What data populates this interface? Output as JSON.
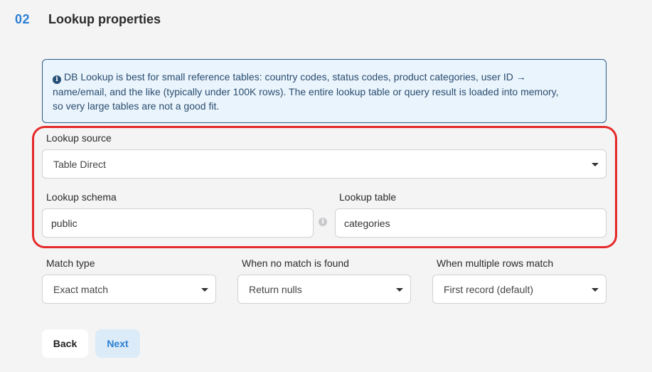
{
  "header": {
    "step_number": "02",
    "title": "Lookup properties"
  },
  "info": {
    "line1": "DB Lookup is best for small reference tables: country codes, status codes, product categories, user ID →",
    "line2": "name/email, and the like (typically under 100K rows). The entire lookup table or query result is loaded into memory,",
    "line3": "so very large tables are not a good fit."
  },
  "lookup_source": {
    "label": "Lookup source",
    "value": "Table Direct"
  },
  "lookup_schema": {
    "label": "Lookup schema",
    "value": "public"
  },
  "lookup_table": {
    "label": "Lookup table",
    "value": "categories"
  },
  "match_type": {
    "label": "Match type",
    "value": "Exact match"
  },
  "no_match": {
    "label": "When no match is found",
    "value": "Return nulls"
  },
  "multiple_rows": {
    "label": "When multiple rows match",
    "value": "First record (default)"
  },
  "buttons": {
    "back": "Back",
    "next": "Next"
  },
  "colors": {
    "accent": "#2a7fd4",
    "highlight": "#e52a2a",
    "info_bg": "#eaf4fc"
  }
}
